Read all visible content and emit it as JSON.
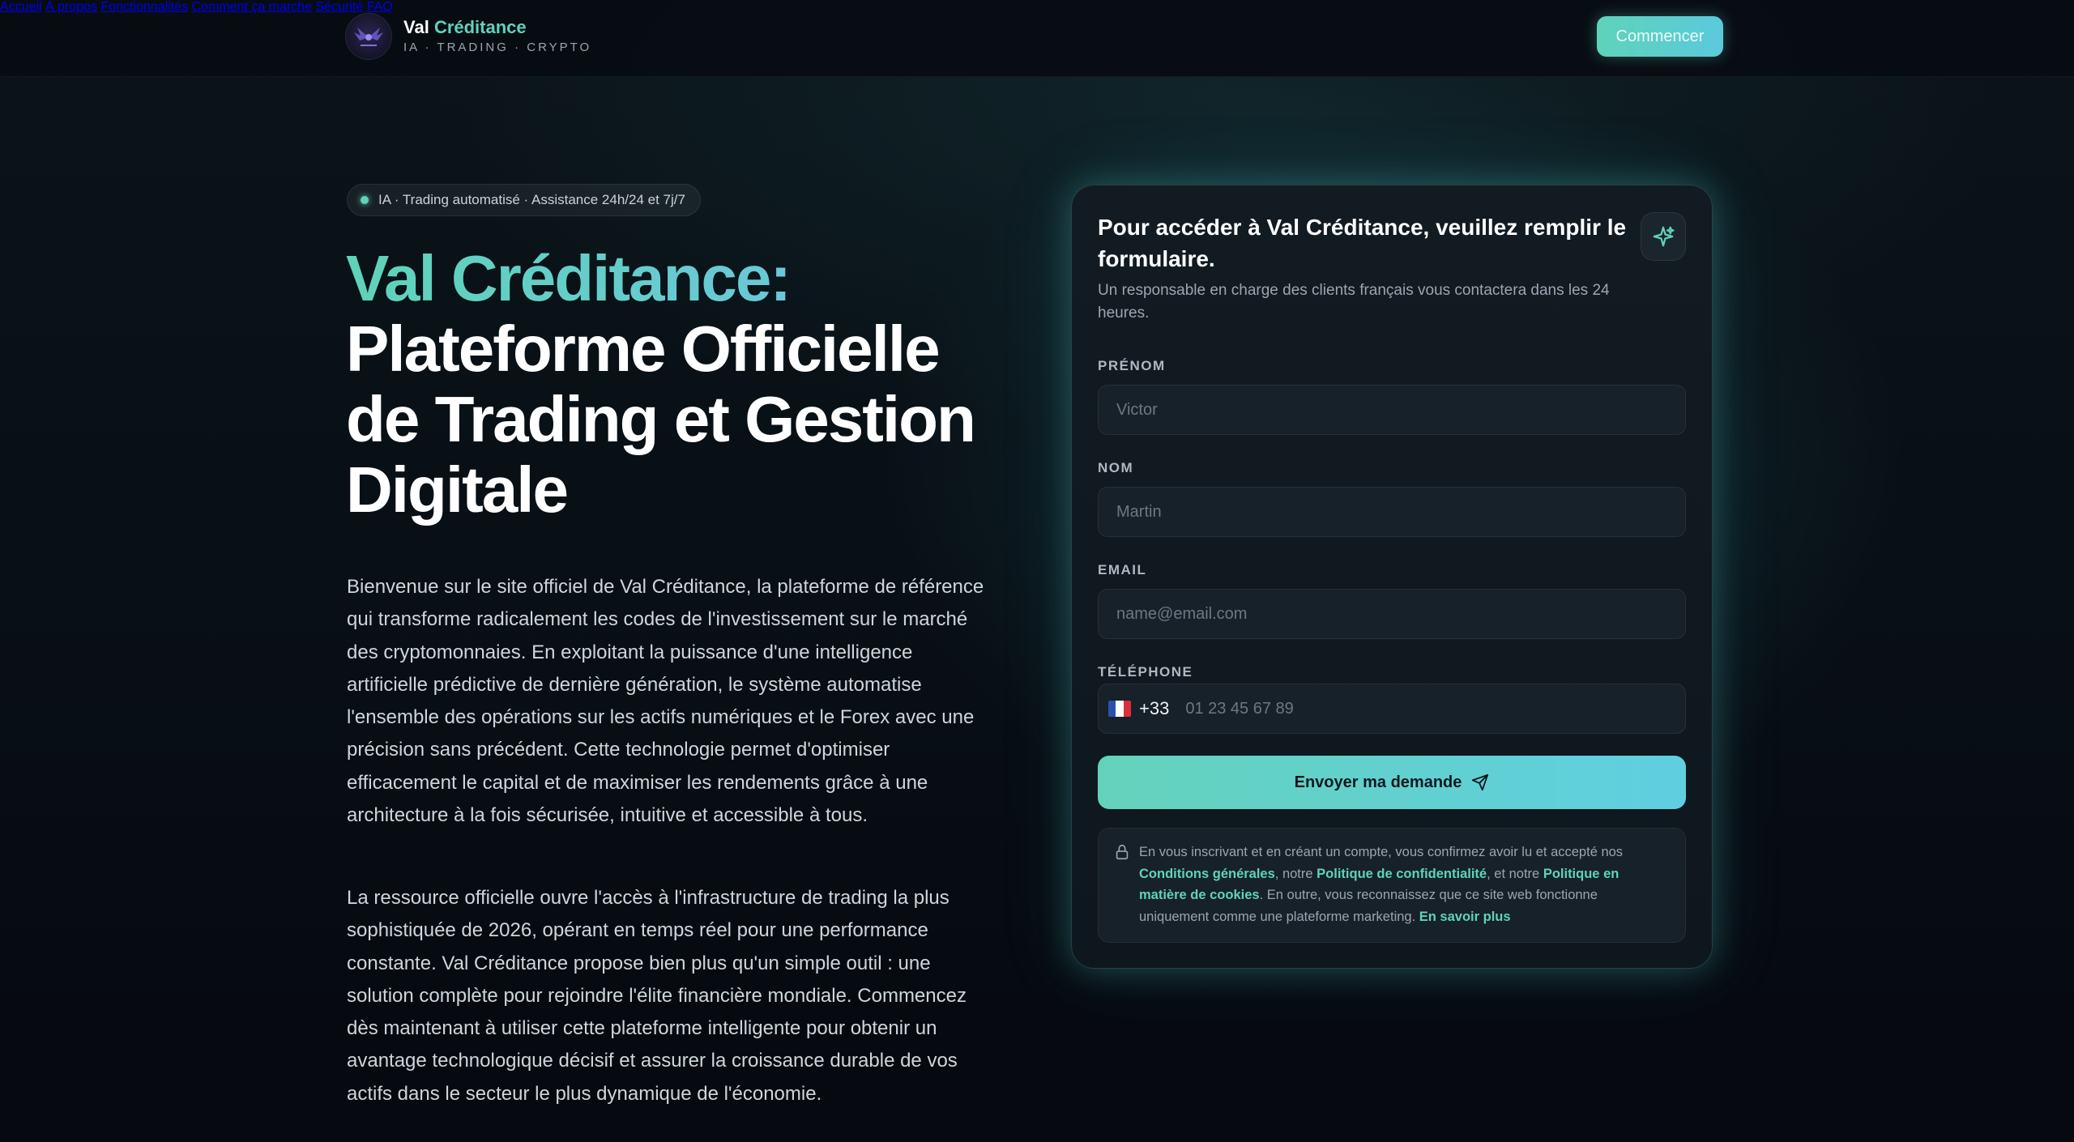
{
  "brand": {
    "name_part1": "Val",
    "name_part2": "Créditance",
    "tagline": "IA · TRADING · CRYPTO",
    "logo_icon": "winged-emblem-icon"
  },
  "nav": {
    "items": [
      "Accueil",
      "À propos",
      "Fonctionnalités",
      "Comment ça marche",
      "Sécurité",
      "FAQ"
    ],
    "cta_label": "Commencer"
  },
  "hero": {
    "badge": "IA · Trading automatisé · Assistance 24h/24 et 7j/7",
    "title_highlight": "Val Créditance:",
    "title_rest": "Plateforme Officielle de Trading et Gestion Digitale",
    "paragraph1": "Bienvenue sur le site officiel de Val Créditance, la plateforme de référence qui transforme radicalement les codes de l'investissement sur le marché des cryptomonnaies. En exploitant la puissance d'une intelligence artificielle prédictive de dernière génération, le système automatise l'ensemble des opérations sur les actifs numériques et le Forex avec une précision sans précédent. Cette technologie permet d'optimiser efficacement le capital et de maximiser les rendements grâce à une architecture à la fois sécurisée, intuitive et accessible à tous.",
    "paragraph2": "La ressource officielle ouvre l'accès à l'infrastructure de trading la plus sophistiquée de 2026, opérant en temps réel pour une performance constante. Val Créditance propose bien plus qu'un simple outil : une solution complète pour rejoindre l'élite financière mondiale. Commencez dès maintenant à utiliser cette plateforme intelligente pour obtenir un avantage technologique décisif et assurer la croissance durable de vos actifs dans le secteur le plus dynamique de l'économie."
  },
  "form": {
    "title": "Pour accéder à Val Créditance, veuillez remplir le formulaire.",
    "subtitle": "Un responsable en charge des clients français vous contactera dans les 24 heures.",
    "firstname_label": "PRÉNOM",
    "firstname_placeholder": "Victor",
    "lastname_label": "NOM",
    "lastname_placeholder": "Martin",
    "email_label": "EMAIL",
    "email_placeholder": "name@email.com",
    "phone_label": "TÉLÉPHONE",
    "phone_dial": "+33",
    "phone_placeholder": "01 23 45 67 89",
    "submit_label": "Envoyer ma demande",
    "legal": {
      "t1": "En vous inscrivant et en créant un compte, vous confirmez avoir lu et accepté nos ",
      "l1": "Conditions générales",
      "t2": ", notre ",
      "l2": "Politique de confidentialité",
      "t3": ", et notre ",
      "l3": "Politique en matière de cookies",
      "t4": ". En outre, vous reconnaissez que ce site web fonctionne uniquement comme une plateforme marketing. ",
      "l4": "En savoir plus"
    }
  },
  "colors": {
    "accent": "#5fd3b9",
    "accent2": "#5bc9dc",
    "background": "#070a10"
  }
}
